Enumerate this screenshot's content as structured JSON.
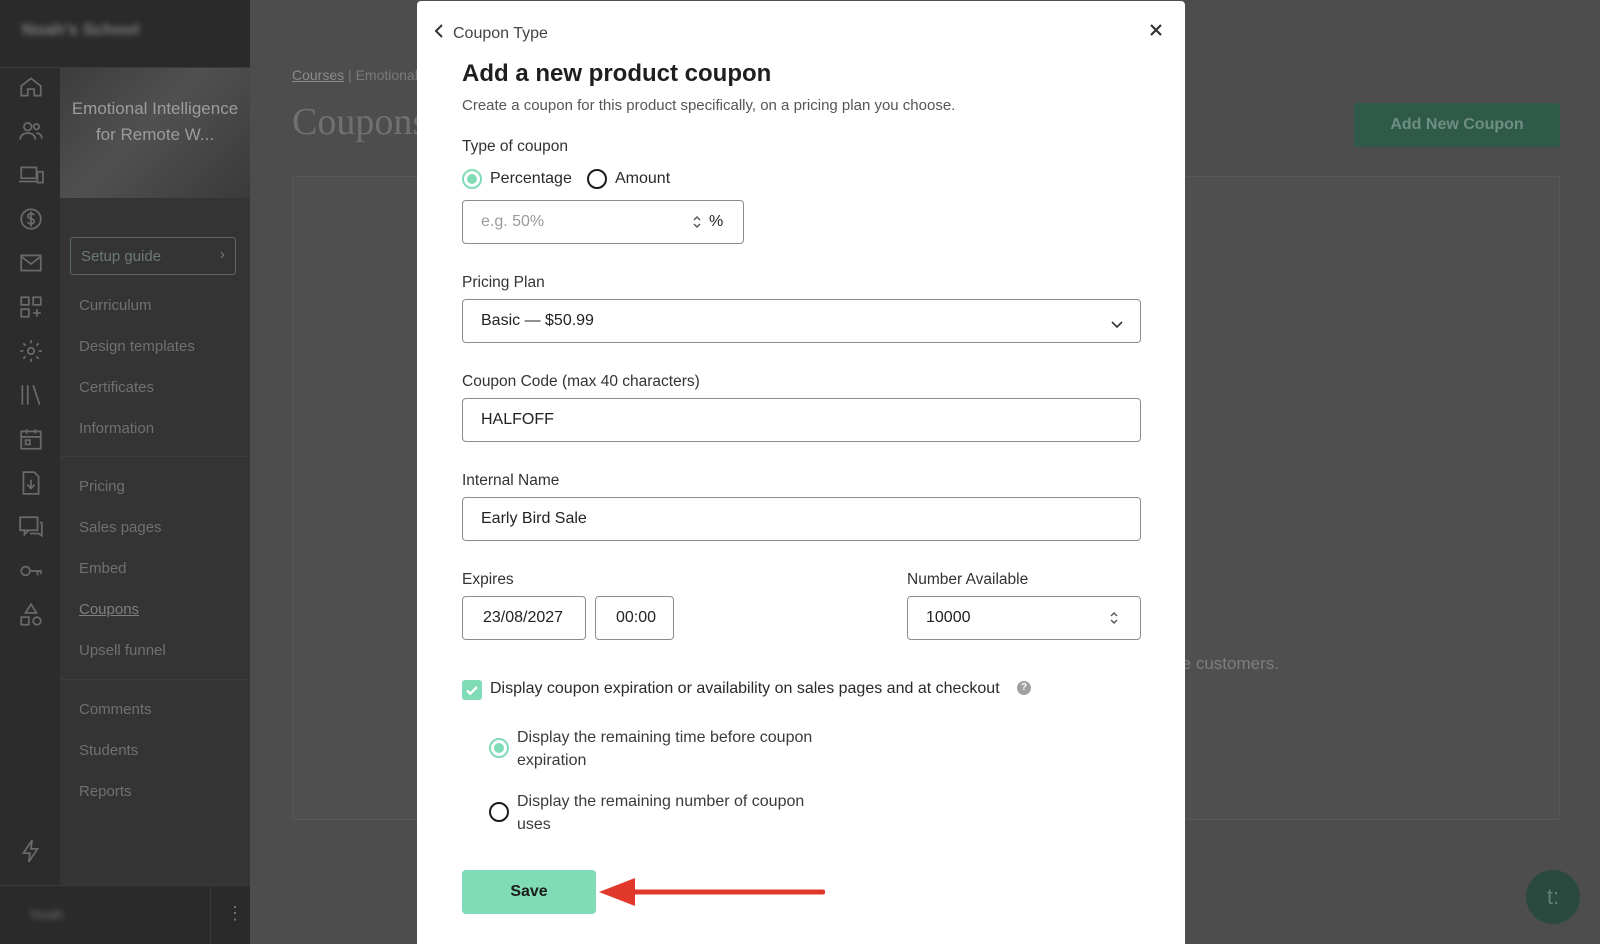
{
  "sidebar": {
    "school_name": "Noah's School",
    "course_title": "Emotional Intelligence for Remote W...",
    "setup_guide": "Setup guide",
    "items": [
      "Curriculum",
      "Design templates",
      "Certificates",
      "Information",
      "Pricing",
      "Sales pages",
      "Embed",
      "Coupons",
      "Upsell funnel",
      "Comments",
      "Students",
      "Reports"
    ],
    "active_item": "Coupons",
    "user": "Noah"
  },
  "page": {
    "breadcrumb_link": "Courses",
    "breadcrumb_sep": "|",
    "breadcrumb_current": "Emotional",
    "title": "Coupons",
    "add_button": "Add New Coupon",
    "empty_line1": "re customers.",
    "empty_line2": ".",
    "chat_label": "t:"
  },
  "modal": {
    "back_label": "Coupon Type",
    "title": "Add a new product coupon",
    "subtitle": "Create a coupon for this product specifically, on a pricing plan you choose.",
    "type_label": "Type of coupon",
    "type_options": [
      "Percentage",
      "Amount"
    ],
    "type_selected": "Percentage",
    "discount_placeholder": "e.g. 50%",
    "discount_unit": "%",
    "plan_label": "Pricing Plan",
    "plan_value": "Basic — $50.99",
    "code_label": "Coupon Code (max 40 characters)",
    "code_value": "HALFOFF",
    "internal_label": "Internal Name",
    "internal_value": "Early Bird Sale",
    "expires_label": "Expires",
    "expires_date": "23/08/2027",
    "expires_time": "00:00",
    "number_label": "Number Available",
    "number_value": "10000",
    "display_check_label": "Display coupon expiration or availability on sales pages and at checkout",
    "display_checked": true,
    "display_option_time": "Display the remaining time before coupon expiration",
    "display_option_uses": "Display the remaining number of coupon uses",
    "display_selected": "time",
    "save_label": "Save"
  },
  "colors": {
    "accent": "#7fdcb7",
    "annotation_arrow": "#e0392b",
    "overlay_bg": "#4d4d4d"
  }
}
